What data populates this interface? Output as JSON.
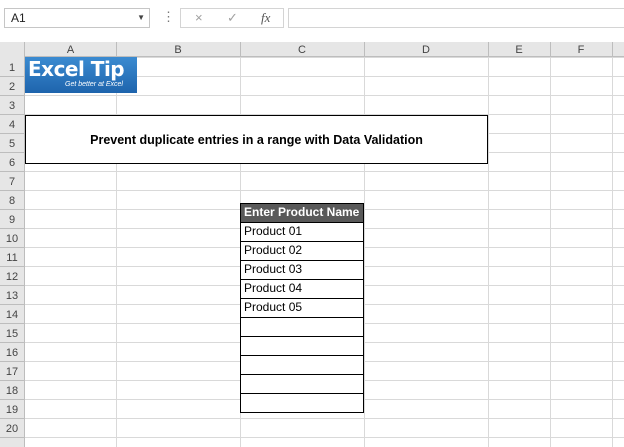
{
  "formula_bar": {
    "name_box": "A1",
    "cancel_icon": "×",
    "enter_icon": "✓",
    "function_icon": "fx",
    "formula": ""
  },
  "columns": [
    "A",
    "B",
    "C",
    "D",
    "E",
    "F"
  ],
  "rows": [
    "1",
    "2",
    "3",
    "4",
    "5",
    "6",
    "7",
    "8",
    "9",
    "10",
    "11",
    "12",
    "13",
    "14",
    "15",
    "16",
    "17",
    "18",
    "19",
    "20"
  ],
  "logo": {
    "main": "Excel Tip",
    "sub": "Get better at Excel"
  },
  "title": "Prevent duplicate entries in a range with Data Validation",
  "table": {
    "header": "Enter Product Name",
    "items": [
      "Product 01",
      "Product 02",
      "Product 03",
      "Product 04",
      "Product 05",
      "",
      "",
      "",
      "",
      ""
    ]
  },
  "colors": {
    "header_bg": "#595959",
    "grid_line": "#d4d4d4",
    "logo_blue": "#2a78c6"
  }
}
